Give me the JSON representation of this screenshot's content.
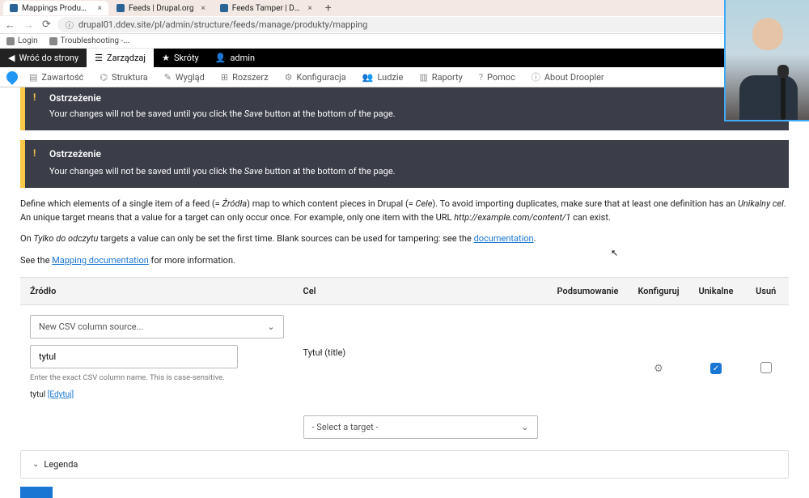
{
  "browser": {
    "tabs": [
      {
        "title": "Mappings Produkty | droopler",
        "active": true
      },
      {
        "title": "Feeds | Drupal.org",
        "active": false
      },
      {
        "title": "Feeds Tamper | Drupal.org",
        "active": false
      }
    ],
    "url": "drupal01.ddev.site/pl/admin/structure/feeds/manage/produkty/mapping",
    "bookmarks": [
      "Login",
      "Troubleshooting -..."
    ]
  },
  "toolbar1": {
    "back": "Wróć do strony",
    "manage": "Zarządzaj",
    "shortcuts": "Skróty",
    "user": "admin"
  },
  "toolbar2": {
    "items": [
      "Zawartość",
      "Struktura",
      "Wygląd",
      "Rozszerz",
      "Konfiguracja",
      "Ludzie",
      "Raporty",
      "Pomoc",
      "About Droopler"
    ]
  },
  "messages": {
    "title": "Ostrzeżenie",
    "body_pre": "Your changes will not be saved until you click the ",
    "body_em": "Save",
    "body_post": " button at the bottom of the page."
  },
  "paragraphs": {
    "p1a": "Define which elements of a single item of a feed (= ",
    "p1_em1": "Źródła",
    "p1b": ") map to which content pieces in Drupal (= ",
    "p1_em2": "Cele",
    "p1c": "). To avoid importing duplicates, make sure that at least one definition has an ",
    "p1_em3": "Unikalny cel",
    "p1d": ". An unique target means that a value for a target can only occur once. For example, only one item with the URL ",
    "p1_em4": "http://example.com/content/1",
    "p1e": " can exist.",
    "p2a": "On ",
    "p2_em": "Tylko do odczytu",
    "p2b": " targets a value can only be set the first time. Blank sources can be used for tampering: see the ",
    "p2_link": "documentation",
    "p2c": ".",
    "p3a": "See the ",
    "p3_link": "Mapping documentation",
    "p3b": " for more information."
  },
  "table": {
    "headers": {
      "source": "Źródło",
      "target": "Cel",
      "summary": "Podsumowanie",
      "configure": "Konfiguruj",
      "unique": "Unikalne",
      "remove": "Usuń"
    },
    "row1": {
      "source_select": "New CSV column source...",
      "source_input": "tytul",
      "source_desc": "Enter the exact CSV column name. This is case-sensitive.",
      "source_existing_label": "tytul",
      "source_existing_link": "[Edytuj]",
      "target": "Tytuł (title)",
      "unique_checked": true
    },
    "target_select": "- Select a target -"
  },
  "legend": "Legenda"
}
